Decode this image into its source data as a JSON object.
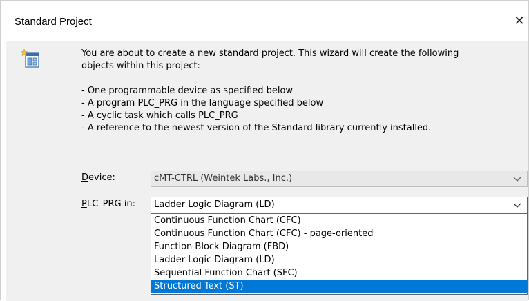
{
  "window": {
    "title": "Standard Project",
    "close_glyph": "✕"
  },
  "icon": "wizard-project-icon",
  "description": {
    "intro_line1": "You are about to create a new standard project. This wizard will create the following",
    "intro_line2": "objects within this project:",
    "bullets": [
      "- One programmable device as specified below",
      "- A program PLC_PRG in the language specified below",
      "- A cyclic task which calls PLC_PRG",
      "- A reference to the newest version of the Standard library currently installed."
    ]
  },
  "device": {
    "label_accel": "D",
    "label_rest": "evice:",
    "value": "cMT-CTRL (Weintek Labs., Inc.)"
  },
  "plc_prg": {
    "label_accel": "P",
    "label_rest": "LC_PRG in:",
    "value": "Ladder Logic Diagram (LD)",
    "options": [
      "Continuous Function Chart (CFC)",
      "Continuous Function Chart (CFC) - page-oriented",
      "Function Block Diagram (FBD)",
      "Ladder Logic Diagram (LD)",
      "Sequential Function Chart (SFC)",
      "Structured Text (ST)"
    ],
    "highlighted_index": 5
  },
  "colors": {
    "accent": "#0078d7",
    "dialog_bg": "#f0f0f0",
    "disabled_combo_bg": "#e8e8e8"
  }
}
